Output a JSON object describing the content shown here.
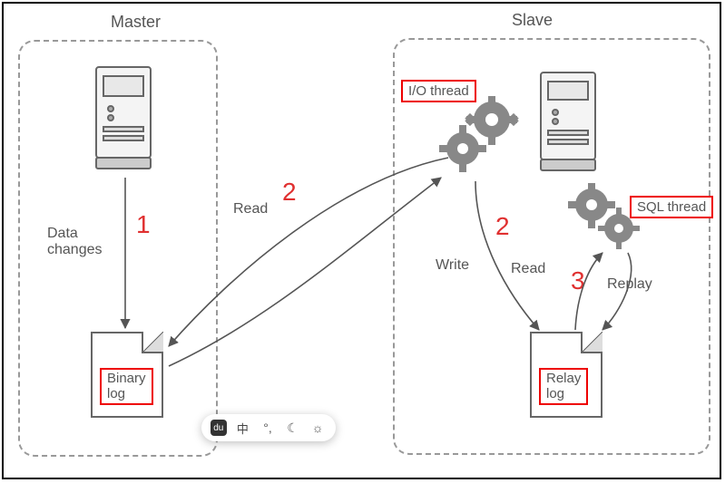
{
  "titles": {
    "master": "Master",
    "slave": "Slave"
  },
  "labels": {
    "data_changes": "Data\nchanges",
    "read1": "Read",
    "write": "Write",
    "read2": "Read",
    "replay": "Replay",
    "io_thread": "I/O thread",
    "sql_thread": "SQL thread"
  },
  "docs": {
    "binary_log": "Binary\nlog",
    "relay_log": "Relay\nlog"
  },
  "numbers": {
    "n1": "1",
    "n2a": "2",
    "n2b": "2",
    "n3": "3"
  },
  "toolbar": {
    "baidu": "du",
    "zhong": "中",
    "deg": "°,",
    "moon": "☾",
    "sun": "☼"
  }
}
